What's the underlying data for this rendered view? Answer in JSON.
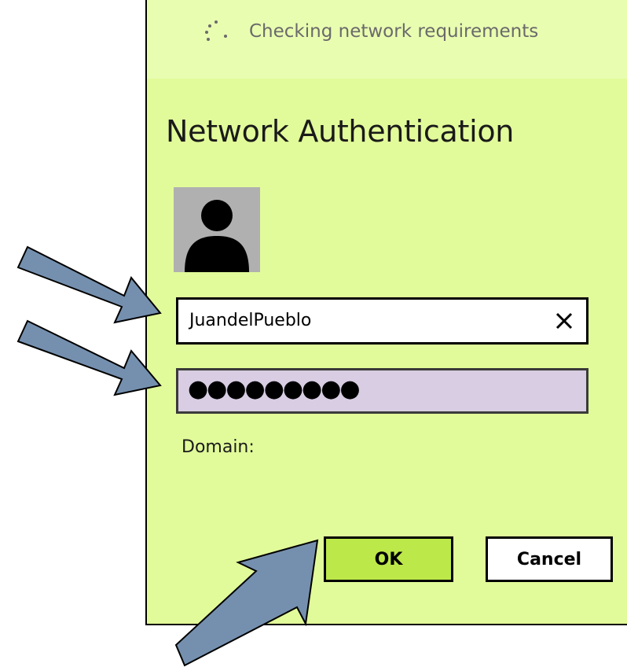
{
  "status": {
    "text": "Checking network requirements",
    "spinner_icon": "loading-spinner-icon"
  },
  "dialog": {
    "title": "Network Authentication",
    "background_color": "#e2fb9a",
    "avatar_icon": "user-avatar-icon"
  },
  "username": {
    "value": "JuandelPueblo",
    "clear_icon": "close-icon"
  },
  "password": {
    "masked_value": "●●●●●●●●●",
    "background_color": "#d8cde3"
  },
  "domain": {
    "label": "Domain:"
  },
  "buttons": {
    "ok_label": "OK",
    "ok_color": "#bde84a",
    "cancel_label": "Cancel"
  },
  "annotations": {
    "arrow_color": "#7590af",
    "arrow_icon": "pointer-arrow-icon"
  }
}
